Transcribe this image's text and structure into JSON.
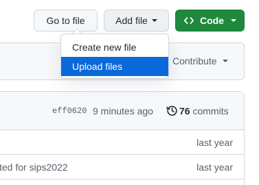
{
  "header": {
    "go_to_file": "Go to file",
    "add_file": "Add file",
    "code": "Code"
  },
  "dropdown": {
    "items": [
      {
        "label": "Create new file"
      },
      {
        "label": "Upload files"
      }
    ],
    "active_index": 1
  },
  "contribute": {
    "label": "Contribute"
  },
  "commit": {
    "hash": "eff0620",
    "ago": "9 minutes ago",
    "count": "76",
    "count_label": "commits"
  },
  "rows": [
    {
      "message": "",
      "time": "last year"
    },
    {
      "message": "ted for sips2022",
      "time": "last year"
    }
  ],
  "colors": {
    "primary": "#1f883d",
    "accent": "#0969da",
    "border": "#d0d7de"
  }
}
